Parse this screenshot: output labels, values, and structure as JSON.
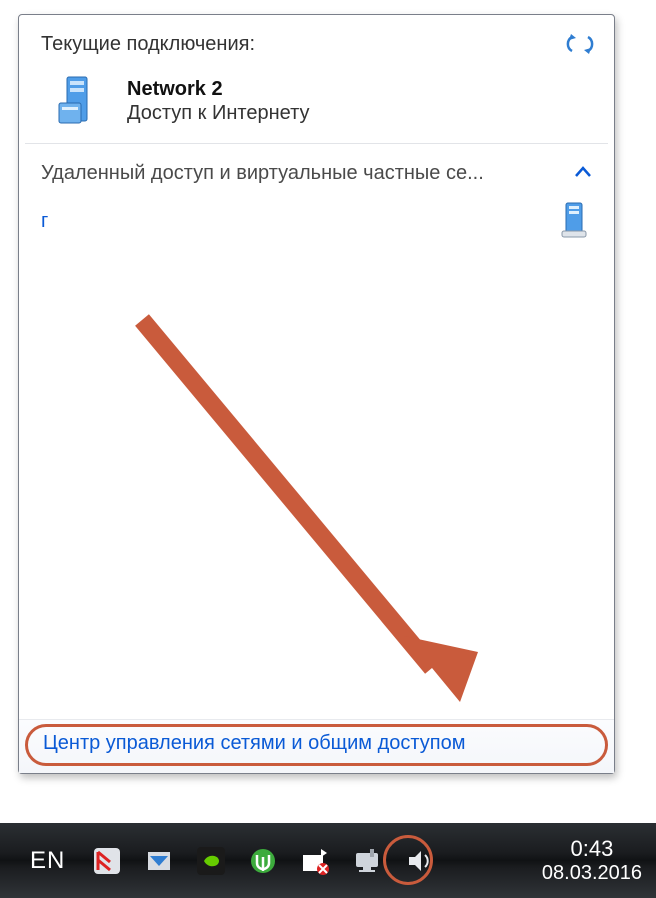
{
  "flyout": {
    "title": "Текущие подключения:",
    "network": {
      "name": "Network  2",
      "status": "Доступ к Интернету"
    },
    "remote_label": "Удаленный доступ и виртуальные частные се...",
    "partial_letter": "г",
    "center_link": "Центр управления сетями и общим доступом"
  },
  "taskbar": {
    "lang": "EN",
    "time": "0:43",
    "date": "08.03.2016"
  }
}
